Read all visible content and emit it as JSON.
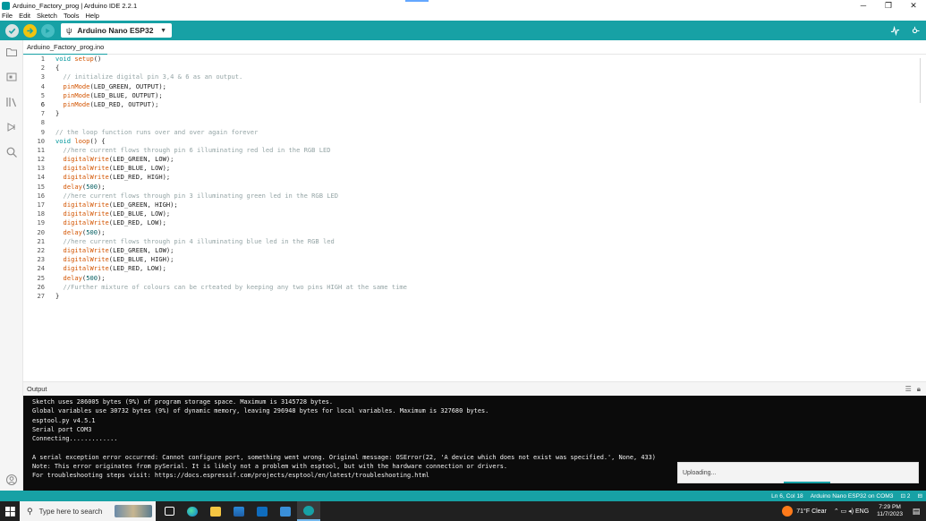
{
  "window": {
    "title": "Arduino_Factory_prog | Arduino IDE 2.2.1",
    "minimize": "─",
    "maximize": "❐",
    "close": "✕"
  },
  "menu": [
    "File",
    "Edit",
    "Sketch",
    "Tools",
    "Help"
  ],
  "toolbar": {
    "board": "Arduino Nano ESP32",
    "usb_glyph": "ψ",
    "caret": "▼"
  },
  "tab": {
    "label": "Arduino_Factory_prog.ino"
  },
  "editor": {
    "lines": [
      "void setup()",
      "{",
      "  // initialize digital pin 3,4 & 6 as an output.",
      "  pinMode(LED_GREEN, OUTPUT);",
      "  pinMode(LED_BLUE, OUTPUT);",
      "  pinMode(LED_RED, OUTPUT);",
      "}",
      "",
      "// the loop function runs over and over again forever",
      "void loop() {",
      "  //here current flows through pin 6 illuminating red led in the RGB LED",
      "  digitalWrite(LED_GREEN, LOW);",
      "  digitalWrite(LED_BLUE, LOW);",
      "  digitalWrite(LED_RED, HIGH);",
      "  delay(500);",
      "  //here current flows through pin 3 illuminating green led in the RGB LED",
      "  digitalWrite(LED_GREEN, HIGH);",
      "  digitalWrite(LED_BLUE, LOW);",
      "  digitalWrite(LED_RED, LOW);",
      "  delay(500);",
      "  //here current flows through pin 4 illuminating blue led in the RGB led",
      "  digitalWrite(LED_GREEN, LOW);",
      "  digitalWrite(LED_BLUE, HIGH);",
      "  digitalWrite(LED_RED, LOW);",
      "  delay(500);",
      "  //Further mixture of colours can be crteated by keeping any two pins HIGH at the same time",
      "}"
    ],
    "active_line": 6
  },
  "output": {
    "title": "Output",
    "lines": [
      "Sketch uses 286005 bytes (9%) of program storage space. Maximum is 3145728 bytes.",
      "Global variables use 30732 bytes (9%) of dynamic memory, leaving 296948 bytes for local variables. Maximum is 327680 bytes.",
      "esptool.py v4.5.1",
      "Serial port COM3",
      "Connecting.............",
      "",
      "A serial exception error occurred: Cannot configure port, something went wrong. Original message: OSError(22, 'A device which does not exist was specified.', None, 433)",
      "Note: This error originates from pySerial. It is likely not a problem with esptool, but with the hardware connection or drivers.",
      "For troubleshooting steps visit: https://docs.espressif.com/projects/esptool/en/latest/troubleshooting.html"
    ]
  },
  "notification": {
    "text": "Uploading..."
  },
  "status": {
    "cursor": "Ln 6, Col 18",
    "board_port": "Arduino Nano ESP32 on COM3",
    "notifications": "⊡ 2",
    "bell": "⊟"
  },
  "taskbar": {
    "search_placeholder": "Type here to search",
    "weather": "71°F  Clear",
    "tray_icons": "⌃ ▭ ◂) ENG",
    "time": "7:29 PM",
    "date": "11/7/2023"
  },
  "colors": {
    "accent": "#17a1a5",
    "upload": "#f1c40f",
    "keyword": "#00979d",
    "function": "#d35400",
    "comment": "#95a5a6"
  }
}
